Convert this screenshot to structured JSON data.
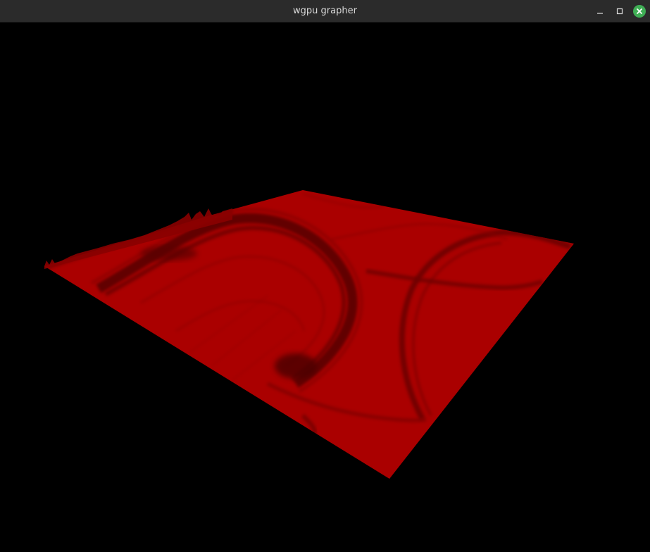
{
  "window": {
    "title": "wgpu grapher",
    "controls": {
      "minimize_icon": "minimize-icon",
      "maximize_icon": "maximize-icon",
      "close_icon": "close-icon",
      "close_color": "#3fae55"
    }
  },
  "scene": {
    "background_color": "#000000",
    "surface_color": "#aa0000",
    "surface_shadow_color": "#5a0000",
    "description_type": "3d-surface-plot"
  }
}
